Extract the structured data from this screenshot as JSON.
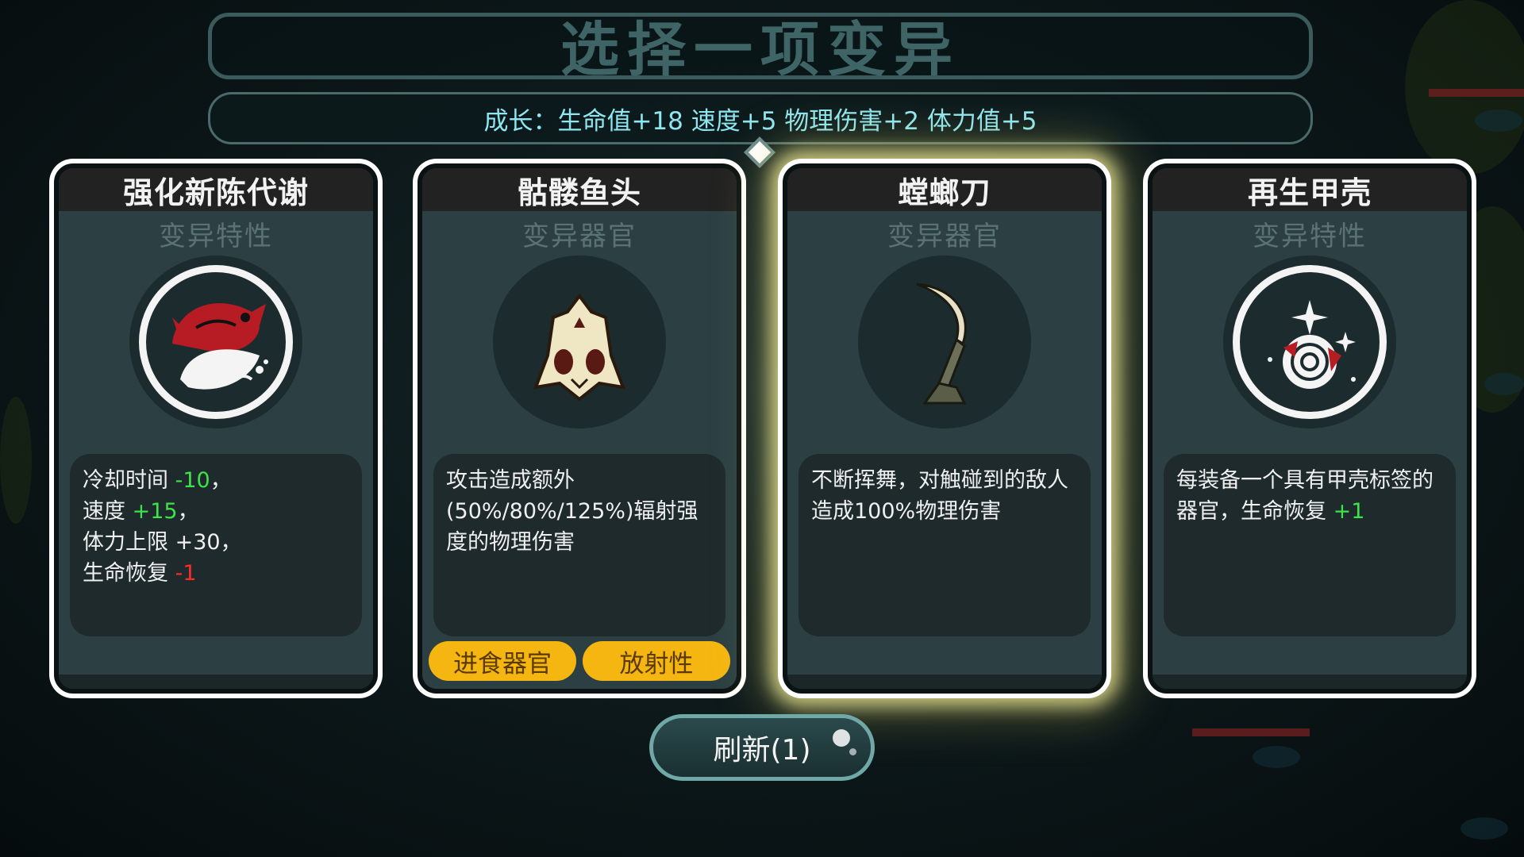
{
  "header": {
    "title": "选择一项变异",
    "growth_label": "成长：",
    "growth_stats": "生命值+18 速度+5 物理伤害+2 体力值+5"
  },
  "cards": [
    {
      "name": "强化新陈代谢",
      "type": "变异特性",
      "icon": "metabolism-fish-icon",
      "desc": [
        {
          "prefix": "冷却时间 ",
          "value": "-10",
          "suffix": "，",
          "color": "green"
        },
        {
          "prefix": "速度 ",
          "value": "+15",
          "suffix": "，",
          "color": "green"
        },
        {
          "prefix": "体力上限 +30，",
          "value": "",
          "suffix": "",
          "color": "white"
        },
        {
          "prefix": "生命恢复 ",
          "value": "-1",
          "suffix": "",
          "color": "red"
        }
      ],
      "tags": []
    },
    {
      "name": "骷髅鱼头",
      "type": "变异器官",
      "icon": "fish-skull-icon",
      "desc_text": "攻击造成额外(50%/80%/125%)辐射强度的物理伤害",
      "tags": [
        "进食器官",
        "放射性"
      ]
    },
    {
      "name": "螳螂刀",
      "type": "变异器官",
      "icon": "mantis-blade-icon",
      "desc_text": "不断挥舞，对触碰到的敌人造成100%物理伤害",
      "tags": [],
      "selected": true
    },
    {
      "name": "再生甲壳",
      "type": "变异特性",
      "icon": "regen-shell-icon",
      "desc_prefix": "每装备一个具有甲壳标签的器官，生命恢复 ",
      "desc_value": "+1",
      "tags": []
    }
  ],
  "refresh_button": {
    "label": "刷新(1)"
  },
  "colors": {
    "accent_cyan": "#8ee6f0",
    "tag_yellow": "#f5b611",
    "positive_green": "#3de34a",
    "negative_red": "#ff2a2a",
    "selected_glow": "#f0ec96"
  }
}
